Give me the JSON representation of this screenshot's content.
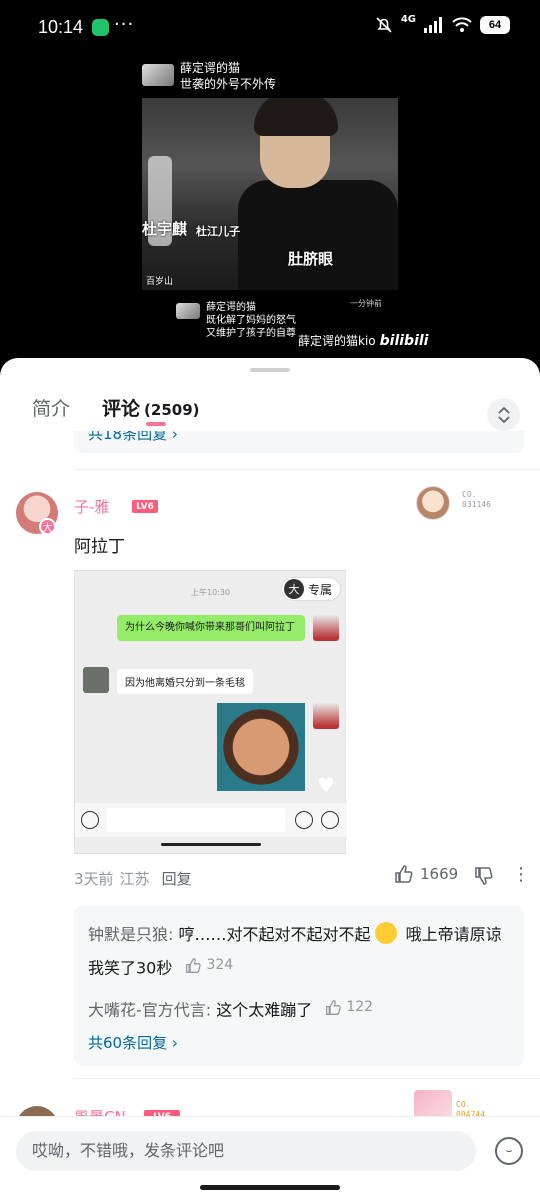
{
  "status": {
    "time": "10:14",
    "more": "···",
    "network": "4G",
    "battery": "64"
  },
  "video": {
    "top_account": "薛定谔的猫",
    "top_caption": "世袭的外号不外传",
    "overlay_name": "杜宇麒",
    "overlay_tag": "杜江儿子",
    "overlay_nick": "肚脐眼",
    "overlay_show": "百岁山",
    "bottom_account": "薛定谔的猫",
    "bottom_line1": "既化解了妈妈的怒气",
    "bottom_line2": "又维护了孩子的自尊",
    "minute_tag": "一分钟前",
    "watermark": "薛定谔的猫kio",
    "watermark_brand": "bilibili"
  },
  "tabs": {
    "intro": "简介",
    "comments": "评论",
    "comment_count": "(2509)"
  },
  "prev_reply_more": "共18条回复 ›",
  "comment": {
    "avatar_badge": "大",
    "username": "子-雅",
    "level": "LV6",
    "fan_no_top": "CO.",
    "fan_no": "031146",
    "text": "阿拉丁",
    "shot": {
      "time": "上午10:30",
      "tag_icon": "大",
      "tag_label": "专属",
      "msg_sent": "为什么今晚你喊你带来那哥们叫阿拉丁",
      "msg_reply": "因为他离婚只分到一条毛毯"
    },
    "date": "3天前",
    "location": "江苏",
    "reply_label": "回复",
    "likes": "1669",
    "replies": [
      {
        "name": "钟默是只狼:",
        "text_a": " 哼……对不起对不起对不起",
        "text_b": " 哦上帝请原谅我笑了30秒",
        "likes": "324"
      },
      {
        "name": "大嘴花-官方代言:",
        "text_a": " 这个太难蹦了",
        "likes": "122"
      }
    ],
    "more_replies": "共60条回复 ›"
  },
  "next_comment": {
    "username": "風景CN",
    "level": "LV6",
    "fan_no_top": "CO.",
    "fan_no": "004744"
  },
  "input": {
    "placeholder": "哎呦，不错哦，发条评论吧"
  }
}
